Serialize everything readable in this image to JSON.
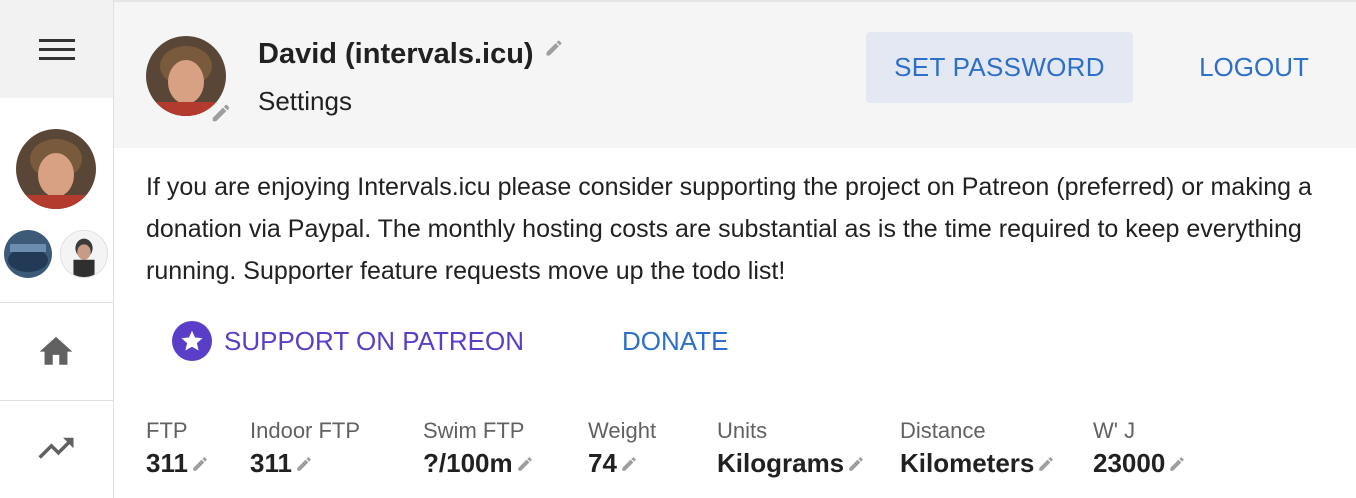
{
  "user": {
    "name": "David (intervals.icu)",
    "page": "Settings"
  },
  "header": {
    "set_password_label": "SET PASSWORD",
    "logout_label": "LOGOUT"
  },
  "support": {
    "message": "If you are enjoying Intervals.icu please consider supporting the project on Patreon (preferred) or making a donation via Paypal. The monthly hosting costs are substantial as is the time required to keep everything running. Supporter feature requests move up the todo list!",
    "patreon_label": "SUPPORT ON PATREON",
    "donate_label": "DONATE"
  },
  "stats": [
    {
      "label": "FTP",
      "value": "311"
    },
    {
      "label": "Indoor FTP",
      "value": "311"
    },
    {
      "label": "Swim FTP",
      "value": "?/100m"
    },
    {
      "label": "Weight",
      "value": "74"
    },
    {
      "label": "Units",
      "value": "Kilograms"
    },
    {
      "label": "Distance",
      "value": "Kilometers"
    },
    {
      "label": "W' J",
      "value": "23000"
    }
  ],
  "icons": {
    "menu": "menu-icon",
    "home": "home-icon",
    "trend": "trending-up-icon",
    "edit": "pencil-icon",
    "star": "star-icon"
  },
  "colors": {
    "accent_blue": "#2d6fc9",
    "patreon_purple": "#5a3ec8",
    "header_bg": "#f5f5f5",
    "set_password_bg": "#e3e8f3"
  }
}
